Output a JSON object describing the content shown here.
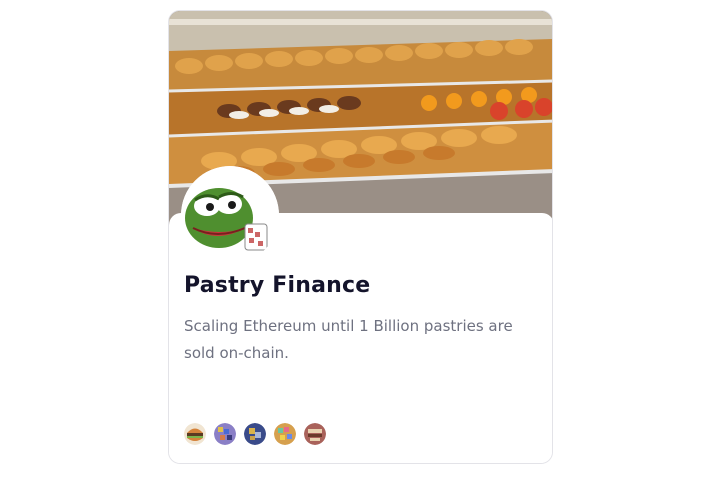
{
  "project": {
    "title": "Pastry Finance",
    "description": "Scaling Ethereum until 1 Billion pastries are sold on-chain.",
    "banner_icon": "pastry-display-image",
    "avatar_icon": "frog-avatar-icon"
  },
  "members": [
    {
      "name": "member-avatar-1",
      "icon": "burger-avatar-icon",
      "color": "#d4823a"
    },
    {
      "name": "member-avatar-2",
      "icon": "pixel-avatar-icon",
      "color": "#8a7fc6"
    },
    {
      "name": "member-avatar-3",
      "icon": "pixel-avatar-icon",
      "color": "#3a4b8a"
    },
    {
      "name": "member-avatar-4",
      "icon": "pixel-avatar-icon",
      "color": "#d6a04e"
    },
    {
      "name": "member-avatar-5",
      "icon": "pixel-avatar-icon",
      "color": "#a9625a"
    }
  ]
}
